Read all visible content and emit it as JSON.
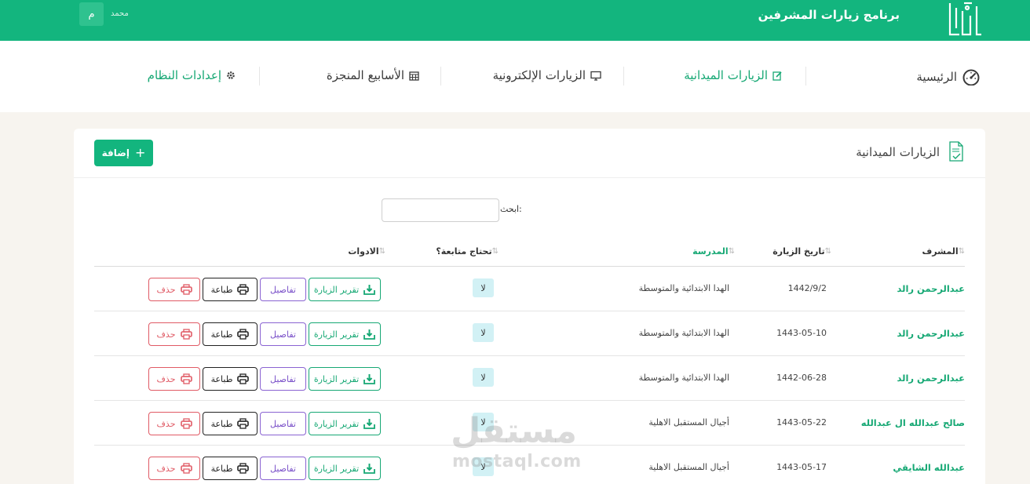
{
  "header": {
    "app_title": "برنامج زيارات المشرفين",
    "user_name": "محمد",
    "avatar_initial": "م",
    "brand_color": "#13b57e"
  },
  "nav": {
    "items": [
      {
        "label": "الرئيسية",
        "icon": "dashboard-gauge-icon",
        "active": false
      },
      {
        "label": "الزيارات الميدانية",
        "icon": "edit-icon",
        "active": true
      },
      {
        "label": "الزيارات الإلكترونية",
        "icon": "monitor-icon",
        "active": false
      },
      {
        "label": "الأسابيع المنجزة",
        "icon": "calendar-icon",
        "active": false
      },
      {
        "label": "إعدادات النظام",
        "icon": "gear-icon",
        "active": true
      }
    ]
  },
  "card": {
    "title": "الزيارات الميدانية",
    "title_icon": "document-check-icon",
    "add_label": "إضافة"
  },
  "search": {
    "label": "ابحث:",
    "value": ""
  },
  "table": {
    "headers": {
      "supervisor": "المشرف",
      "date": "تاريخ الزيارة",
      "school": "المدرسة",
      "follow_up": "تحتاج متابعة؟",
      "tools": "الادوات"
    },
    "actions": {
      "report": "تقرير الزيارة",
      "details": "تفاصيل",
      "print": "طباعة",
      "delete": "حذف"
    },
    "rows": [
      {
        "supervisor": "عبدالرحمن رالد",
        "date": "1442/9/2",
        "school": "الهدا الابتدائية والمتوسطة",
        "follow_up": "لا"
      },
      {
        "supervisor": "عبدالرحمن رالد",
        "date": "1443-05-10",
        "school": "الهدا الابتدائية والمتوسطة",
        "follow_up": "لا"
      },
      {
        "supervisor": "عبدالرحمن رالد",
        "date": "1442-06-28",
        "school": "الهدا الابتدائية والمتوسطة",
        "follow_up": "لا"
      },
      {
        "supervisor": "صالح عبدالله ال عبدالله",
        "date": "1443-05-22",
        "school": "أجيال المستقبل الاهلية",
        "follow_up": "لا"
      },
      {
        "supervisor": "عبدالله الشايقي",
        "date": "1443-05-17",
        "school": "أجيال المستقبل الاهلية",
        "follow_up": "لا"
      }
    ]
  },
  "watermark": {
    "arabic": "مستقل",
    "latin": "mostaql.com"
  }
}
